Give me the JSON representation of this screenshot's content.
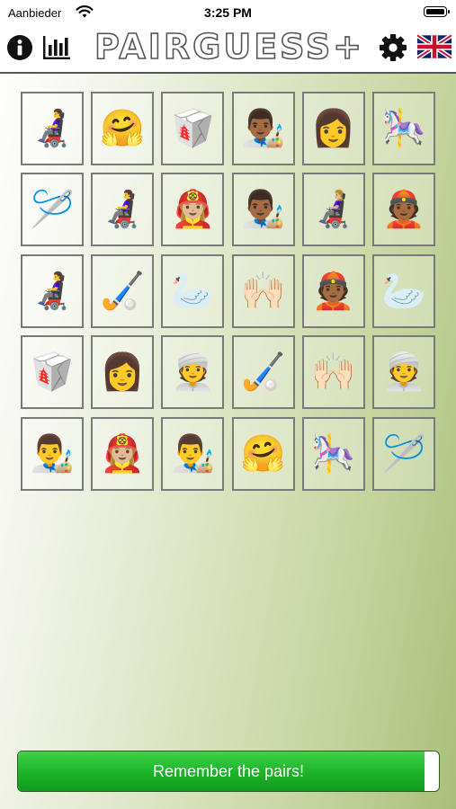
{
  "status_bar": {
    "carrier": "Aanbieder",
    "time": "3:25 PM"
  },
  "header": {
    "title": "PAIRGUESS+",
    "icons": {
      "info": "info-icon",
      "stats": "bar-chart-icon",
      "settings": "gear-icon",
      "language": "uk-flag-icon"
    }
  },
  "grid": {
    "rows": 5,
    "columns": 6,
    "tiles": [
      [
        "👩‍🦼",
        "🤗",
        "🥡",
        "👨🏾‍🎨",
        "👩",
        "🎠"
      ],
      [
        "🪡",
        "👩‍🦼",
        "👩🏼‍🚒",
        "👨🏾‍🎨",
        "👩🏼‍🦼",
        "👲🏾"
      ],
      [
        "👩‍🦼",
        "🏑",
        "🦢",
        "🙌🏻",
        "👲🏾",
        "🦢"
      ],
      [
        "🥡",
        "👩",
        "👳",
        "🏑",
        "🙌🏻",
        "👳"
      ],
      [
        "👨‍🎨",
        "👩🏼‍🚒",
        "👨‍🎨",
        "🤗",
        "🎠",
        "🪡"
      ]
    ]
  },
  "action": {
    "label": "Remember the pairs!",
    "progress": 0.965
  },
  "colors": {
    "progress_green": "#1fb52a",
    "title_outline": "#555555"
  }
}
